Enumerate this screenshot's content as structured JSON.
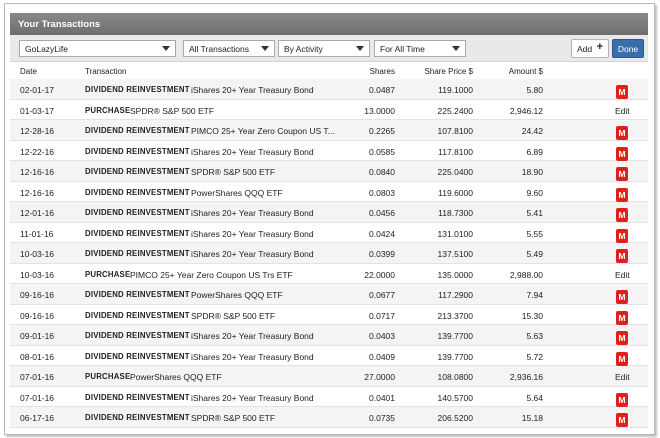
{
  "title": "Your Transactions",
  "filters": {
    "account": "GoLazyLife",
    "transaction_type": "All Transactions",
    "group_by": "By Activity",
    "period": "For All Time"
  },
  "actions": {
    "add_label": "Add",
    "add_symbol": "+",
    "done_label": "Done"
  },
  "columns": {
    "date": "Date",
    "transaction": "Transaction",
    "shares": "Shares",
    "price": "Share Price $",
    "amount": "Amount $"
  },
  "badge_label": "M",
  "edit_label": "Edit",
  "rows": [
    {
      "date": "02-01-17",
      "type": "DIVIDEND REINVESTMENT",
      "name": "iShares 20+ Year Treasury Bond",
      "shares": "0.0487",
      "price": "119.1000",
      "amount": "5.80",
      "action": "badge"
    },
    {
      "date": "01-03-17",
      "type": "PURCHASE",
      "name": "SPDR® S&P 500 ETF",
      "shares": "13.0000",
      "price": "225.2400",
      "amount": "2,946.12",
      "action": "edit"
    },
    {
      "date": "12-28-16",
      "type": "DIVIDEND REINVESTMENT",
      "name": "PIMCO 25+ Year Zero Coupon US T...",
      "shares": "0.2265",
      "price": "107.8100",
      "amount": "24.42",
      "action": "badge"
    },
    {
      "date": "12-22-16",
      "type": "DIVIDEND REINVESTMENT",
      "name": "iShares 20+ Year Treasury Bond",
      "shares": "0.0585",
      "price": "117.8100",
      "amount": "6.89",
      "action": "badge"
    },
    {
      "date": "12-16-16",
      "type": "DIVIDEND REINVESTMENT",
      "name": "SPDR® S&P 500 ETF",
      "shares": "0.0840",
      "price": "225.0400",
      "amount": "18.90",
      "action": "badge"
    },
    {
      "date": "12-16-16",
      "type": "DIVIDEND REINVESTMENT",
      "name": "PowerShares QQQ ETF",
      "shares": "0.0803",
      "price": "119.6000",
      "amount": "9.60",
      "action": "badge"
    },
    {
      "date": "12-01-16",
      "type": "DIVIDEND REINVESTMENT",
      "name": "iShares 20+ Year Treasury Bond",
      "shares": "0.0456",
      "price": "118.7300",
      "amount": "5.41",
      "action": "badge"
    },
    {
      "date": "11-01-16",
      "type": "DIVIDEND REINVESTMENT",
      "name": "iShares 20+ Year Treasury Bond",
      "shares": "0.0424",
      "price": "131.0100",
      "amount": "5.55",
      "action": "badge"
    },
    {
      "date": "10-03-16",
      "type": "DIVIDEND REINVESTMENT",
      "name": "iShares 20+ Year Treasury Bond",
      "shares": "0.0399",
      "price": "137.5100",
      "amount": "5.49",
      "action": "badge"
    },
    {
      "date": "10-03-16",
      "type": "PURCHASE",
      "name": "PIMCO 25+ Year Zero Coupon US Trs ETF",
      "shares": "22.0000",
      "price": "135.0000",
      "amount": "2,988.00",
      "action": "edit"
    },
    {
      "date": "09-16-16",
      "type": "DIVIDEND REINVESTMENT",
      "name": "PowerShares QQQ ETF",
      "shares": "0.0677",
      "price": "117.2900",
      "amount": "7.94",
      "action": "badge"
    },
    {
      "date": "09-16-16",
      "type": "DIVIDEND REINVESTMENT",
      "name": "SPDR® S&P 500 ETF",
      "shares": "0.0717",
      "price": "213.3700",
      "amount": "15.30",
      "action": "badge"
    },
    {
      "date": "09-01-16",
      "type": "DIVIDEND REINVESTMENT",
      "name": "iShares 20+ Year Treasury Bond",
      "shares": "0.0403",
      "price": "139.7700",
      "amount": "5.63",
      "action": "badge"
    },
    {
      "date": "08-01-16",
      "type": "DIVIDEND REINVESTMENT",
      "name": "iShares 20+ Year Treasury Bond",
      "shares": "0.0409",
      "price": "139.7700",
      "amount": "5.72",
      "action": "badge"
    },
    {
      "date": "07-01-16",
      "type": "PURCHASE",
      "name": "PowerShares QQQ ETF",
      "shares": "27.0000",
      "price": "108.0800",
      "amount": "2,936.16",
      "action": "edit"
    },
    {
      "date": "07-01-16",
      "type": "DIVIDEND REINVESTMENT",
      "name": "iShares 20+ Year Treasury Bond",
      "shares": "0.0401",
      "price": "140.5700",
      "amount": "5.64",
      "action": "badge"
    },
    {
      "date": "06-17-16",
      "type": "DIVIDEND REINVESTMENT",
      "name": "SPDR® S&P 500 ETF",
      "shares": "0.0735",
      "price": "206.5200",
      "amount": "15.18",
      "action": "badge"
    }
  ]
}
